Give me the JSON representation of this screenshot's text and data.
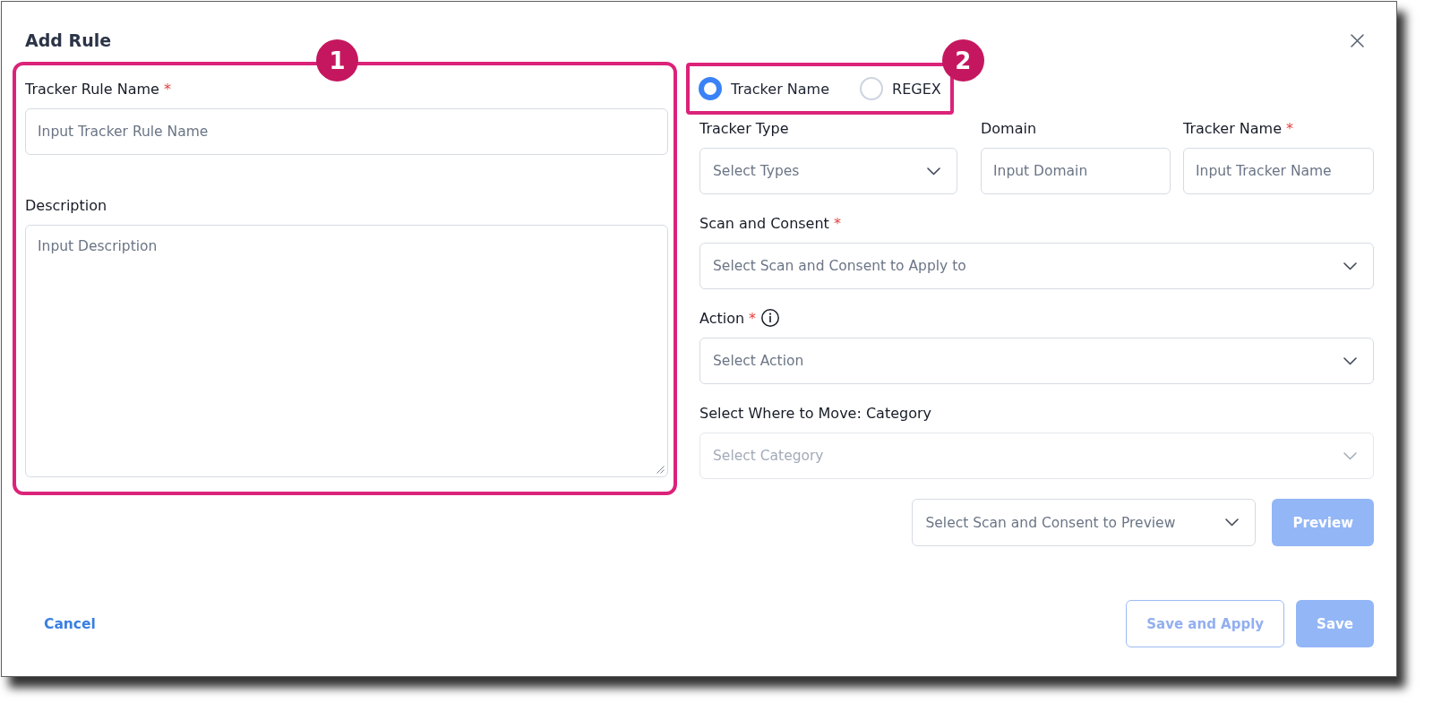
{
  "dialog": {
    "title": "Add Rule"
  },
  "rule_panel": {
    "annotation": "1",
    "fields": [
      {
        "kind": "input",
        "label": "Tracker Rule Name",
        "required_mark": "*",
        "placeholder": "Input Tracker Rule Name"
      },
      {
        "kind": "textarea",
        "label": "Description",
        "placeholder": "Input Description"
      }
    ]
  },
  "match_mode": {
    "annotation": "2",
    "options": [
      {
        "label": "Tracker Name",
        "selected": true
      },
      {
        "label": "REGEX",
        "selected": false
      }
    ]
  },
  "tracker_fields": [
    {
      "kind": "select",
      "label": "Tracker Type",
      "placeholder": "Select Types"
    },
    {
      "kind": "input",
      "label": "Domain",
      "placeholder": "Input Domain"
    },
    {
      "kind": "input",
      "label": "Tracker Name",
      "required_mark": "*",
      "placeholder": "Input Tracker Name"
    }
  ],
  "rule_fields": [
    {
      "kind": "select",
      "label": "Scan and Consent",
      "required_mark": "*",
      "disabled": false,
      "placeholder": "Select Scan and Consent to Apply to"
    },
    {
      "kind": "select",
      "label": "Action",
      "required_mark": "*",
      "info": true,
      "disabled": false,
      "placeholder": "Select Action"
    },
    {
      "kind": "select",
      "label": "Select Where to Move: Category",
      "disabled": true,
      "placeholder": "Select Category"
    }
  ],
  "preview": {
    "select": {
      "kind": "select",
      "placeholder": "Select Scan and Consent to Preview"
    },
    "button": {
      "kind": "primary",
      "label": "Preview",
      "disabled": true
    }
  },
  "footer": {
    "cancel": {
      "label": "Cancel"
    },
    "buttons": [
      {
        "kind": "outline",
        "label": "Save and Apply",
        "disabled": true
      },
      {
        "kind": "primary",
        "label": "Save",
        "disabled": true
      }
    ]
  }
}
